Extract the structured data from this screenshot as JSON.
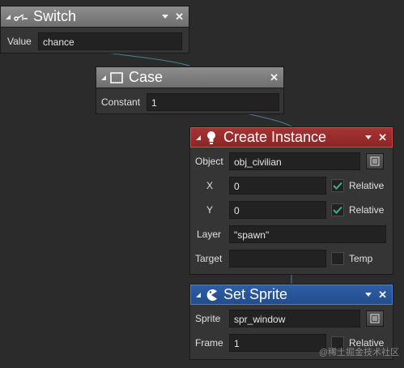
{
  "nodes": {
    "switch": {
      "title": "Switch",
      "icon": "switch-icon",
      "value_label": "Value",
      "value": "chance"
    },
    "case": {
      "title": "Case",
      "icon": "case-bracket-icon",
      "constant_label": "Constant",
      "constant": "1"
    },
    "create_instance": {
      "title": "Create Instance",
      "icon": "lightbulb-icon",
      "header_color": "#8c2626",
      "object_label": "Object",
      "object": "obj_civilian",
      "x_label": "X",
      "x": "0",
      "x_relative": true,
      "y_label": "Y",
      "y": "0",
      "y_relative": true,
      "relative_label": "Relative",
      "layer_label": "Layer",
      "layer": "\"spawn\"",
      "target_label": "Target",
      "target": "",
      "temp_label": "Temp",
      "temp": false
    },
    "set_sprite": {
      "title": "Set Sprite",
      "icon": "pacman-icon",
      "header_color": "#234c8c",
      "sprite_label": "Sprite",
      "sprite": "spr_window",
      "frame_label": "Frame",
      "frame": "1",
      "relative_label": "Relative",
      "frame_relative": false
    }
  },
  "watermark": "@稀土掘金技术社区"
}
